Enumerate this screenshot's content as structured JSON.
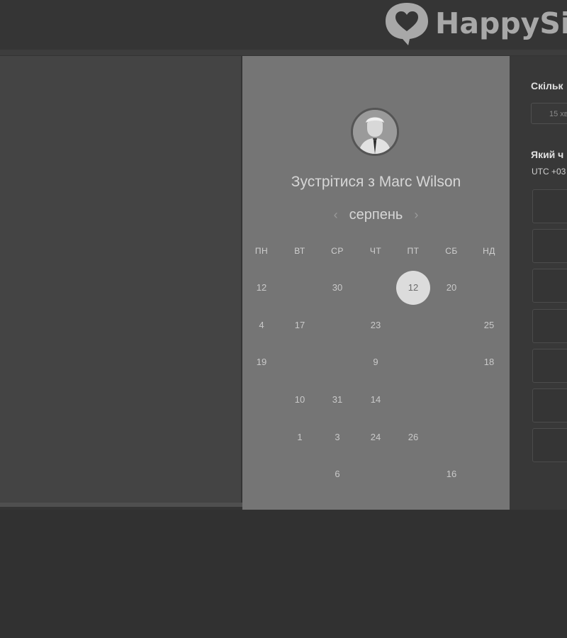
{
  "brand": {
    "name": "HappySig"
  },
  "scheduler": {
    "title": "Зустрітися з Marc Wilson",
    "month": "серпень",
    "prev_icon": "‹",
    "next_icon": "›",
    "weekdays": [
      "ПН",
      "ВТ",
      "СР",
      "ЧТ",
      "ПТ",
      "СБ",
      "НД"
    ],
    "weeks": [
      [
        "12",
        "",
        "30",
        "",
        "12",
        "20",
        ""
      ],
      [
        "4",
        "17",
        "",
        "23",
        "",
        "",
        "25"
      ],
      [
        "19",
        "",
        "",
        "9",
        "",
        "",
        "18"
      ],
      [
        "",
        "10",
        "31",
        "14",
        "",
        "",
        ""
      ],
      [
        "",
        "1",
        "3",
        "24",
        "26",
        "",
        ""
      ],
      [
        "",
        "",
        "6",
        "",
        "",
        "16",
        ""
      ]
    ],
    "selected_day": "12"
  },
  "options": {
    "duration_label": "Скільк",
    "duration_value": "15 хв",
    "time_label": "Який ч",
    "timezone": "UTC +03"
  },
  "colors": {
    "background": "#343434",
    "center_panel": "#757575",
    "selected_circle": "#dcdcdc"
  }
}
